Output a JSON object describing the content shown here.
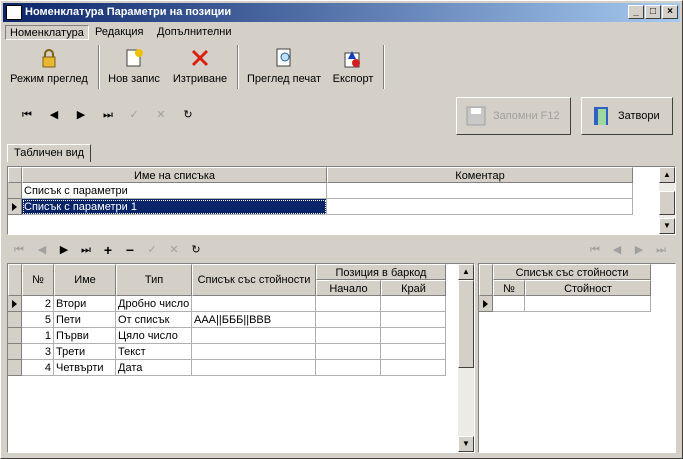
{
  "window": {
    "title": "Номенклатура Параметри на позиции"
  },
  "menu": [
    {
      "label": "Номенклатура"
    },
    {
      "label": "Редакция"
    },
    {
      "label": "Допълнителни"
    }
  ],
  "toolbar": {
    "view_mode": "Режим преглед",
    "new": "Нов запис",
    "delete": "Изтриване",
    "preview": "Преглед печат",
    "export": "Експорт"
  },
  "actions": {
    "save": "Запомни  F12",
    "close": "Затвори"
  },
  "tab": {
    "label": "Табличен вид"
  },
  "lists": {
    "headers": [
      "Име на списъка",
      "Коментар"
    ],
    "rows": [
      {
        "name": "Списък с параметри",
        "comment": ""
      },
      {
        "name": "Списък с параметри 1",
        "comment": ""
      }
    ]
  },
  "params": {
    "headers": {
      "no": "№",
      "name": "Име",
      "type": "Тип",
      "values": "Списък със стойности",
      "pos": "Позиция в баркод",
      "start": "Начало",
      "end": "Край"
    },
    "rows": [
      {
        "no": "2",
        "name": "Втори",
        "type": "Дробно число",
        "values": "",
        "start": "",
        "end": ""
      },
      {
        "no": "5",
        "name": "Пети",
        "type": "От списък",
        "values": "ААА||БББ||ВВВ",
        "start": "",
        "end": ""
      },
      {
        "no": "1",
        "name": "Първи",
        "type": "Цяло число",
        "values": "",
        "start": "",
        "end": ""
      },
      {
        "no": "3",
        "name": "Трети",
        "type": "Текст",
        "values": "",
        "start": "",
        "end": ""
      },
      {
        "no": "4",
        "name": "Четвърти",
        "type": "Дата",
        "values": "",
        "start": "",
        "end": ""
      }
    ]
  },
  "values_grid": {
    "title": "Списък със стойности",
    "headers": {
      "no": "№",
      "value": "Стойност"
    }
  },
  "colors": {
    "title_start": "#0a246a",
    "title_end": "#a6caf0",
    "selection": "#0a246a"
  }
}
